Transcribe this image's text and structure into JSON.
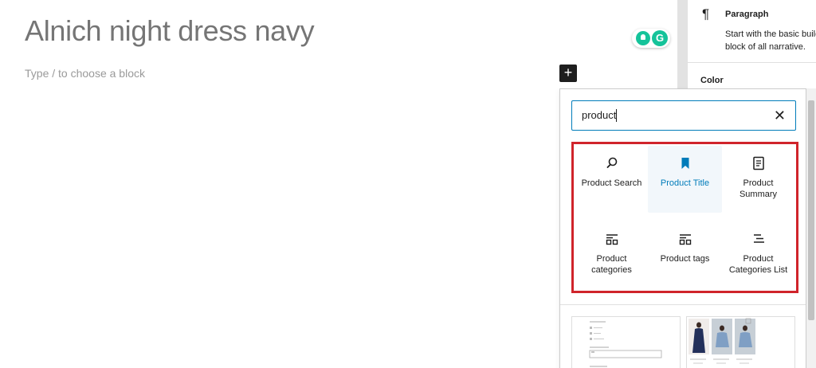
{
  "editor": {
    "post_title": "Alnich night dress navy",
    "block_placeholder": "Type / to choose a block",
    "inserter_toggle": "+"
  },
  "grammarly": {
    "logo_letter": "G"
  },
  "sidebar": {
    "block_icon": "¶",
    "block_title": "Paragraph",
    "block_description": "Start with the basic building block of all narrative.",
    "section_color": "Color"
  },
  "inserter": {
    "search_value": "product",
    "clear_icon": "✕",
    "blocks": [
      {
        "label": "Product Search",
        "icon": "search-icon",
        "selected": false
      },
      {
        "label": "Product Title",
        "icon": "bookmark-icon",
        "selected": true
      },
      {
        "label": "Product Summary",
        "icon": "document-icon",
        "selected": false
      },
      {
        "label": "Product categories",
        "icon": "categories-icon",
        "selected": false
      },
      {
        "label": "Product tags",
        "icon": "tags-icon",
        "selected": false
      },
      {
        "label": "Product Categories List",
        "icon": "list-icon",
        "selected": false
      }
    ],
    "accent_color": "#007cba",
    "highlight_color": "#d0242b"
  }
}
